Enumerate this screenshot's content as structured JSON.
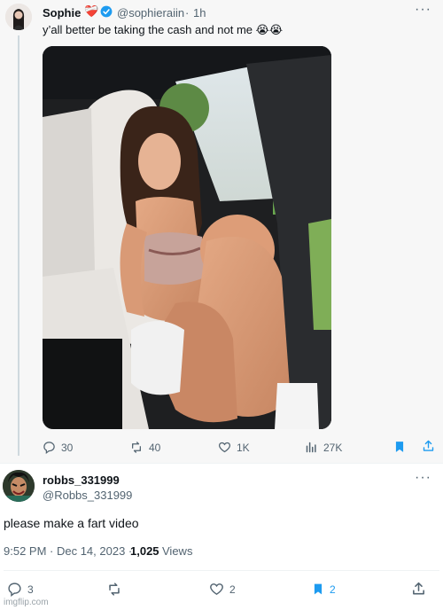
{
  "tweet": {
    "author_name": "Sophie",
    "author_emoji": "❤️‍🩹",
    "handle": "@sophieraiin",
    "separator": "·",
    "time": "1h",
    "more": "···",
    "text": "y’all better be taking the cash and not me 😭😭",
    "stats": {
      "replies": "30",
      "retweets": "40",
      "likes": "1K",
      "views": "27K"
    }
  },
  "reply": {
    "author_name": "robbs_331999",
    "handle": "@Robbs_331999",
    "more": "···",
    "text": "please make a fart video",
    "timestamp": "9:52 PM · Dec 14, 2023 ·",
    "views_count": "1,025",
    "views_label": "Views",
    "stats": {
      "replies": "3",
      "likes": "2",
      "bookmarks": "2"
    }
  },
  "watermark": "imgflip.com",
  "colors": {
    "accent": "#1d9bf0",
    "muted": "#536471",
    "text": "#0f1419",
    "heart": "#e0245e"
  },
  "icons": [
    "reply-icon",
    "retweet-icon",
    "like-icon",
    "views-icon",
    "bookmark-icon",
    "share-icon",
    "verified-icon",
    "more-icon"
  ]
}
